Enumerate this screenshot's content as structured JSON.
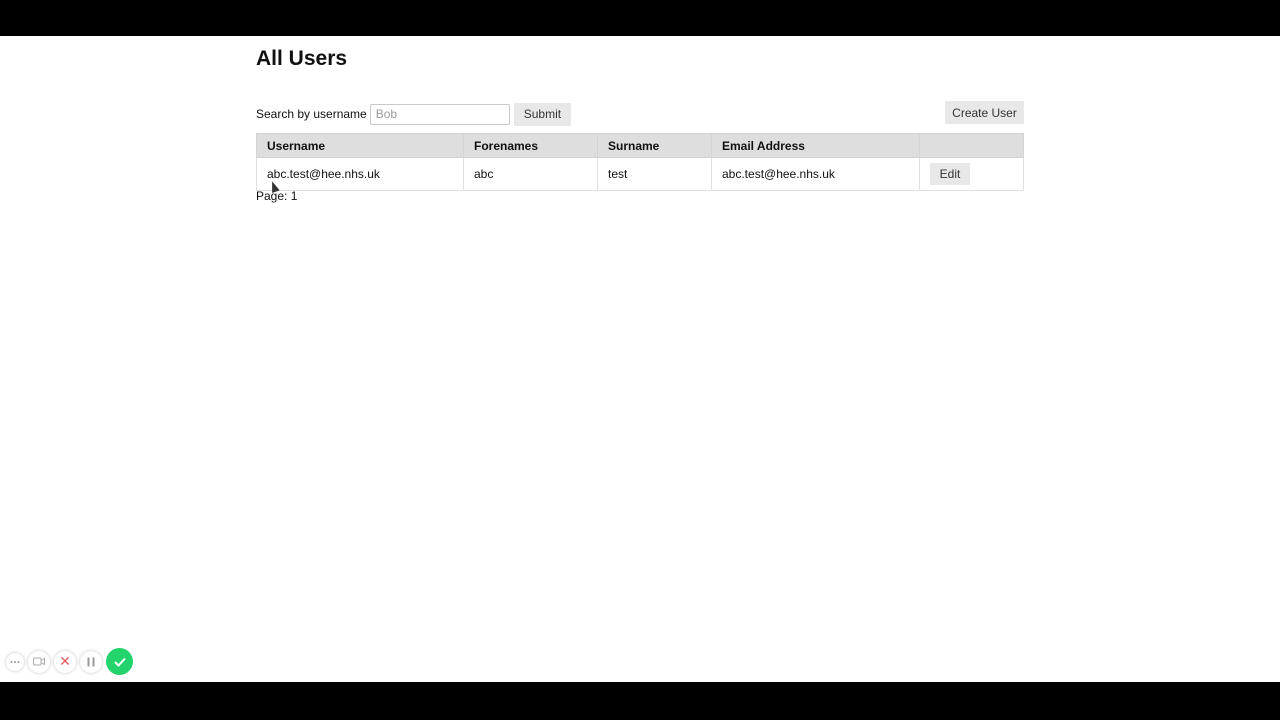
{
  "page": {
    "title": "All Users"
  },
  "search": {
    "label": "Search by username",
    "placeholder": "Bob",
    "value": "",
    "submit_label": "Submit"
  },
  "actions": {
    "create_user_label": "Create User"
  },
  "table": {
    "columns": [
      "Username",
      "Forenames",
      "Surname",
      "Email Address",
      ""
    ],
    "rows": [
      {
        "username": "abc.test@hee.nhs.uk",
        "forenames": "abc",
        "surname": "test",
        "email": "abc.test@hee.nhs.uk",
        "action_label": "Edit"
      }
    ]
  },
  "pagination": {
    "label": "Page: 1"
  },
  "recorder": {
    "more_icon": "ellipsis-icon",
    "camera_icon": "video-camera-icon",
    "cancel_icon": "close-icon",
    "pause_icon": "pause-icon",
    "done_icon": "checkmark-icon",
    "done_color": "#22d46b"
  }
}
